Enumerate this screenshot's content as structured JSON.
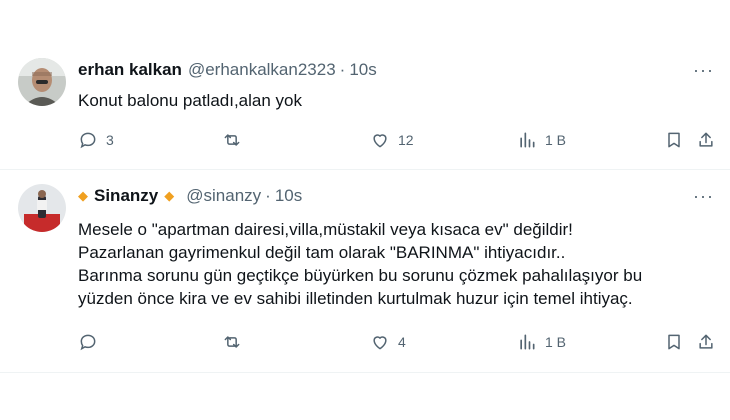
{
  "tweets": [
    {
      "name": "erhan kalkan",
      "handle": "@erhankalkan2323",
      "time": "10s",
      "badge": false,
      "text_lines": [
        "Konut balonu patladı,alan yok"
      ],
      "actions": {
        "replies": "3",
        "reposts": "",
        "likes": "12",
        "views": "1 B"
      }
    },
    {
      "name": "Sinanzy",
      "handle": "@sinanzy",
      "time": "10s",
      "badge": true,
      "badge_color": "#f0a020",
      "text_lines": [
        "Mesele o \"apartman dairesi,villa,müstakil veya kısaca ev\" değildir!",
        "Pazarlanan gayrimenkul değil tam olarak \"BARINMA\" ihtiyacıdır..",
        "Barınma sorunu gün geçtikçe büyürken bu sorunu çözmek pahalılaşıyor bu",
        "yüzden önce kira ve ev sahibi illetinden kurtulmak huzur için temel ihtiyaç."
      ],
      "actions": {
        "replies": "",
        "reposts": "",
        "likes": "4",
        "views": "1 B"
      }
    }
  ],
  "icons": [
    "reply-icon",
    "repost-icon",
    "like-icon",
    "views-icon",
    "bookmark-icon",
    "share-icon",
    "more-icon",
    "diamond-icon"
  ],
  "separator": "·",
  "more_label": "···"
}
